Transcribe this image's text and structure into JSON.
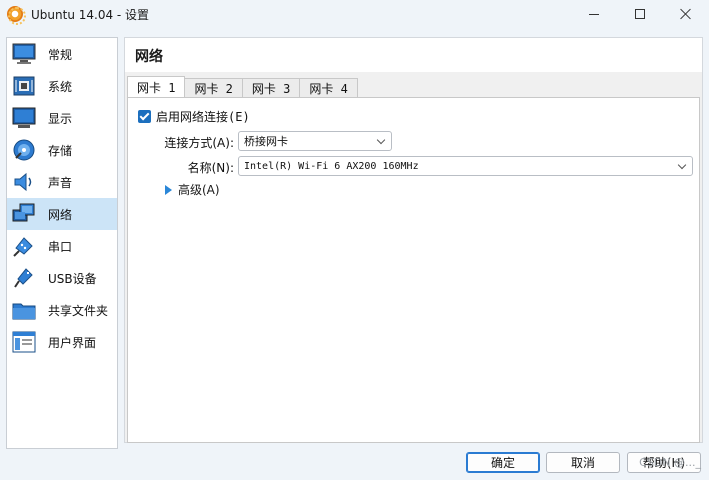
{
  "window": {
    "title": "Ubuntu 14.04 - 设置",
    "app_icon": "virtualbox-gear-icon",
    "minimize": "minimize-icon",
    "maximize": "maximize-icon",
    "close": "close-icon"
  },
  "sidebar": {
    "items": [
      {
        "label": "常规",
        "icon": "general-monitor-icon",
        "active": false
      },
      {
        "label": "系统",
        "icon": "system-chip-icon",
        "active": false
      },
      {
        "label": "显示",
        "icon": "display-monitor-icon",
        "active": false
      },
      {
        "label": "存储",
        "icon": "storage-disc-icon",
        "active": false
      },
      {
        "label": "声音",
        "icon": "audio-speaker-icon",
        "active": false
      },
      {
        "label": "网络",
        "icon": "network-icon",
        "active": true
      },
      {
        "label": "串口",
        "icon": "serial-port-icon",
        "active": false
      },
      {
        "label": "USB设备",
        "icon": "usb-icon",
        "active": false
      },
      {
        "label": "共享文件夹",
        "icon": "shared-folder-icon",
        "active": false
      },
      {
        "label": "用户界面",
        "icon": "user-interface-icon",
        "active": false
      }
    ]
  },
  "main": {
    "title": "网络",
    "tabs": [
      {
        "label": "网卡 1",
        "active": true
      },
      {
        "label": "网卡 2",
        "active": false
      },
      {
        "label": "网卡 3",
        "active": false
      },
      {
        "label": "网卡 4",
        "active": false
      }
    ],
    "enable_label": "启用网络连接(E)",
    "enable_checked": true,
    "attached_label": "连接方式(A):",
    "attached_value": "桥接网卡",
    "name_label": "名称(N):",
    "name_value": "Intel(R) Wi-Fi 6 AX200 160MHz",
    "advanced_label": "高级(A)"
  },
  "buttons": {
    "ok": "确定",
    "cancel": "取消",
    "help": "帮助(H)"
  },
  "watermark": "CSDN @..._",
  "colors": {
    "accent": "#1c6fbe",
    "selection": "#cce4f7",
    "window_bg": "#eff4f9"
  }
}
